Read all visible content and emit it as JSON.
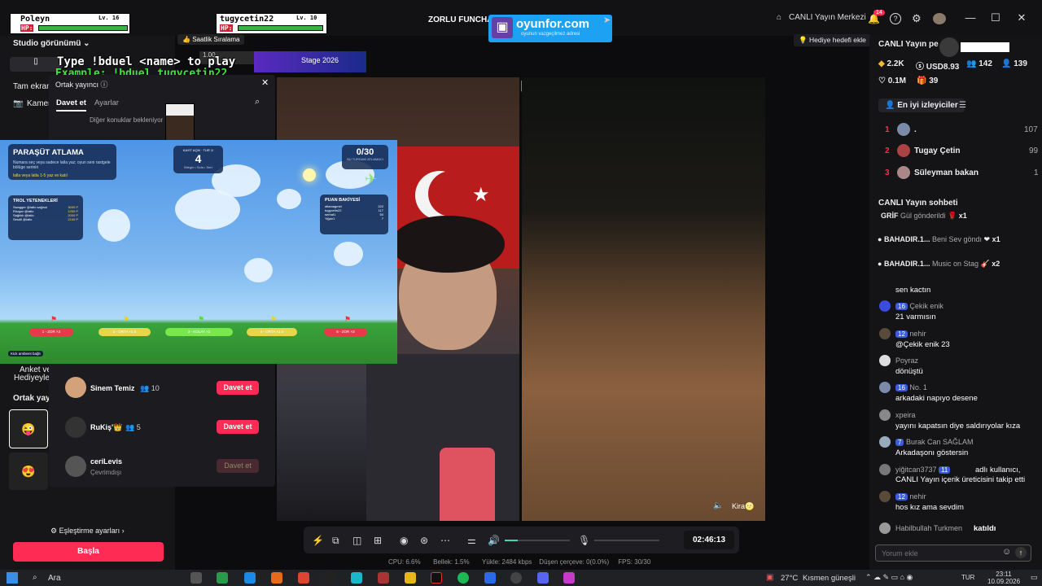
{
  "titlebar": {
    "title": "ZORLU FUNCHAL",
    "center_brand": "oyunfor.com",
    "center_sub": "oyunun vazgeçilmez adresi",
    "live_center": "CANLI Yayın Merkezi",
    "notif_count": "14"
  },
  "overlay": {
    "player1": {
      "name": "Poleyn",
      "level": "Lv. 16",
      "hp": "HP:"
    },
    "player2": {
      "name": "tugycetin22",
      "level": "Lv. 10",
      "hp": "HP:"
    },
    "duel_line1": "Type !bduel <name> to play",
    "duel_line2": "Example: !bduel tugycetin22",
    "hourly": "Saatlik Sıralama",
    "stage": "Stage 2026",
    "gift_goal": "Hediye hedefi ekle"
  },
  "leftpanel": {
    "studio_view": "Studio görünümü",
    "fullscreen": "Tam ekran",
    "camera": "Kamera",
    "cohost_title": "Ortak yayıncı",
    "tab_invite": "Davet et",
    "tab_settings": "Ayarlar",
    "waiting": "Diğer konuklar bekleniyor",
    "poll": "Anket ve",
    "gifts": "Hediyeyle",
    "cohost_section": "Ortak yay",
    "match_settings": "Eşleştirme ayarları",
    "start": "Başla",
    "invitees": [
      {
        "name": "Sinem Temiz",
        "count": "10",
        "button": "Davet et",
        "sub": ""
      },
      {
        "name": "RuKiş'👑",
        "count": "5",
        "button": "Davet et",
        "sub": ""
      },
      {
        "name": "ceriLevis",
        "count": "",
        "button": "Davet et",
        "sub": "Çevrimdışı"
      }
    ]
  },
  "game": {
    "title": "PARAŞÜT ATLAMA",
    "desc": "Numara seç veya sadece latla yaz; oyun seni rastgele bölüge seriniri",
    "desc2": "latla veya latla 1-5 yaz ve katıl",
    "round_label": "KAYIT AÇIK · TUR 1!",
    "round_num": "4",
    "round_sub": "Bilegin • Sola • Sert",
    "score": "0/30",
    "score_label": "BU TURDAKİ ATLAMACI",
    "troll_title": "TROL YETENEKLERİ",
    "trolls": [
      {
        "name": "Swagger @latlo sağ/sol",
        "val": "3000 P"
      },
      {
        "name": "Rüzgar @latlo",
        "val": "1200 P"
      },
      {
        "name": "Sağlıklı @latlo",
        "val": "2000 P"
      },
      {
        "name": "Sesdil @latlo",
        "val": "2100 P"
      }
    ],
    "points_title": "PUAN BAKİYESİ",
    "points": [
      {
        "name": "atlamagmel",
        "val": "222"
      },
      {
        "name": "tugycetin22",
        "val": "117"
      },
      {
        "name": "serhat1",
        "val": "50"
      },
      {
        "name": "Yiğan1",
        "val": "7"
      }
    ],
    "zones": [
      "1 - ZOR ×3",
      "2 - ORTA ×1.5",
      "3 - KOLAY ×1",
      "4 - ORTA ×1.5",
      "5 - ZOR ×3"
    ],
    "footer": "Kick ambient bağlı"
  },
  "video": {
    "right_name": "Kira🌝"
  },
  "rightpanel": {
    "header": "CANLI Yayın pe",
    "stats": {
      "coins": "2.2K",
      "usd": "USD8.93",
      "viewers": "142",
      "followers": "139",
      "likes": "0.1M",
      "gifts": "39"
    },
    "top_viewers_btn": "En iyi izleyiciler",
    "top": [
      {
        "rank": "1",
        "name": ".",
        "score": "107"
      },
      {
        "rank": "2",
        "name": "Tugay Çetin",
        "score": "99"
      },
      {
        "rank": "3",
        "name": "Süleyman bakan",
        "score": "1"
      }
    ],
    "chat_title": "CANLI Yayın sohbeti",
    "gift_rows": [
      {
        "name": "GRİF",
        "text": "Gül gönderildi",
        "mult": "x1"
      },
      {
        "name": "BAHADIR.1...",
        "text": "Beni Sev göndı",
        "mult": "x1"
      },
      {
        "name": "BAHADIR.1...",
        "text": "Music on Stag",
        "mult": "x2"
      }
    ],
    "chat": [
      {
        "name": "",
        "badge": "",
        "msg": "sen kactın"
      },
      {
        "name": "Çekik enik",
        "badge": "16",
        "msg": "21 varmısın"
      },
      {
        "name": "nehir",
        "badge": "12",
        "msg": "@Çekik enik 23"
      },
      {
        "name": "Poyraz",
        "badge": "",
        "msg": "dönüştü"
      },
      {
        "name": "No. 1",
        "badge": "16",
        "msg": "arkadaki napıyo desene"
      },
      {
        "name": "xpeira",
        "badge": "",
        "msg": "yayını kapatsın diye saldırıyolar kıza"
      },
      {
        "name": "Burak Can SAĞLAM",
        "badge": "7",
        "msg": "Arkadaşonı göstersin"
      },
      {
        "name": "yiğitcan3737",
        "badge": "11",
        "msg": "adlı kullanıcı, CANLI Yayın içerik üreticisini takip etti"
      },
      {
        "name": "nehir",
        "badge": "12",
        "msg": "hos kız ama sevdim"
      },
      {
        "name": "Habilbullah Turkmen",
        "badge": "",
        "msg": "katıldı"
      }
    ],
    "comment_placeholder": "Yorum ekle"
  },
  "toolbar": {
    "timer": "02:46:13"
  },
  "status": {
    "cpu": "CPU: 6.6%",
    "mem": "Bellek: 1.5%",
    "upload": "Yükle: 2484 kbps",
    "dropped": "Düşen çerçeve: 0(0.0%)",
    "fps": "FPS: 30/30"
  },
  "taskbar": {
    "search": "Ara",
    "weather": "27°C",
    "weather_desc": "Kısmen güneşli",
    "lang": "TUR",
    "time": "23:11",
    "date": "10.09.2026"
  }
}
